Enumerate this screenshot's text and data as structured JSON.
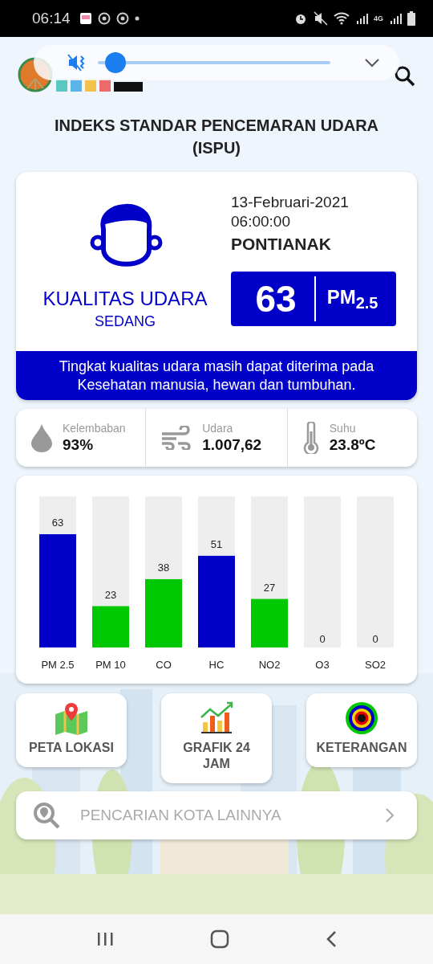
{
  "status_bar": {
    "time": "06:14",
    "network": "4G"
  },
  "volume_popup": {
    "muted": true,
    "level": 0.03
  },
  "title": "INDEKS STANDAR PENCEMARAN UDARA (ISPU)",
  "summary": {
    "quality_label": "KUALITAS UDARA",
    "category": "SEDANG",
    "date": "13-Februari-2021",
    "time": "06:00:00",
    "city": "PONTIANAK",
    "index": "63",
    "pollutant": "PM$_{2.5}$",
    "message": "Tingkat kualitas udara masih dapat diterima pada Kesehatan manusia, hewan dan tumbuhan."
  },
  "weather": [
    {
      "kind": "humidity",
      "label": "Kelembaban",
      "value": "93%"
    },
    {
      "kind": "wind",
      "label": "Udara",
      "value": "1.007,62"
    },
    {
      "kind": "temperature",
      "label": "Suhu",
      "value": "23.8ºC"
    }
  ],
  "pollutants": {
    "chart_data": {
      "type": "bar",
      "categories": [
        "PM 2.5",
        "PM 10",
        "CO",
        "HC",
        "NO2",
        "O3",
        "SO2"
      ],
      "values": [
        63,
        23,
        38,
        51,
        27,
        0,
        0
      ],
      "data_labels": true
    }
  },
  "menu": [
    {
      "kind": "map",
      "label": "PETA LOKASI"
    },
    {
      "kind": "chart",
      "label": "GRAFIK 24 JAM"
    },
    {
      "kind": "legend",
      "label": "KETERANGAN"
    }
  ],
  "search": {
    "placeholder": "PENCARIAN KOTA LAINNYA"
  }
}
